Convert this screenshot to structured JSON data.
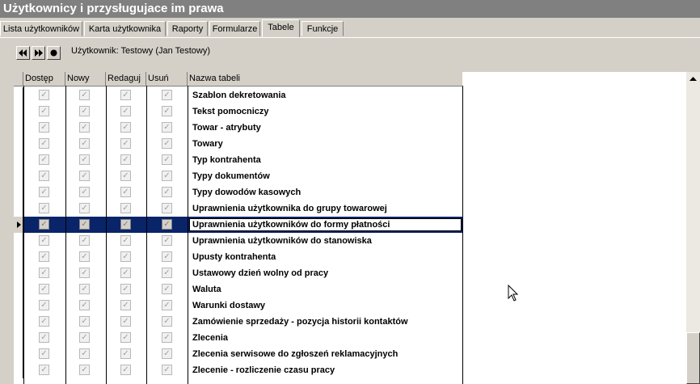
{
  "window": {
    "title": "Użytkownicy i przysługujace im prawa"
  },
  "tabs": [
    {
      "label": "Lista użytkowników"
    },
    {
      "label": "Karta użytkownika"
    },
    {
      "label": "Raporty"
    },
    {
      "label": "Formularze"
    },
    {
      "label": "Tabele"
    },
    {
      "label": "Funkcje"
    }
  ],
  "active_tab": "Tabele",
  "toolbar": {
    "first": "⏮",
    "next": "⏭",
    "record": "●"
  },
  "user_info": "Użytkownik: Testowy  (Jan Testowy)",
  "columns": [
    "Dostęp",
    "Nowy",
    "Redaguj",
    "Usuń",
    "Nazwa tabeli"
  ],
  "rows": [
    {
      "name": "Szablon dekretowania"
    },
    {
      "name": "Tekst pomocniczy"
    },
    {
      "name": "Towar - atrybuty"
    },
    {
      "name": "Towary"
    },
    {
      "name": "Typ kontrahenta"
    },
    {
      "name": "Typy dokumentów"
    },
    {
      "name": "Typy dowodów kasowych"
    },
    {
      "name": "Uprawnienia użytkownika do grupy towarowej"
    },
    {
      "name": "Uprawnienia użytkowników do formy płatności"
    },
    {
      "name": "Uprawnienia użytkowników do stanowiska"
    },
    {
      "name": "Upusty kontrahenta"
    },
    {
      "name": "Ustawowy dzień wolny od pracy"
    },
    {
      "name": "Waluta"
    },
    {
      "name": "Warunki dostawy"
    },
    {
      "name": "Zamówienie sprzedaży - pozycja historii kontaktów"
    },
    {
      "name": "Zlecenia"
    },
    {
      "name": "Zlecenia serwisowe do zgłoszeń reklamacyjnych"
    },
    {
      "name": "Zlecenie - rozliczenie czasu pracy"
    }
  ],
  "selected_row": 8,
  "checkbox_glyph": "✓",
  "colors": {
    "selection": "#0a246a",
    "title_bar": "#808080",
    "face": "#d4d0c8"
  }
}
